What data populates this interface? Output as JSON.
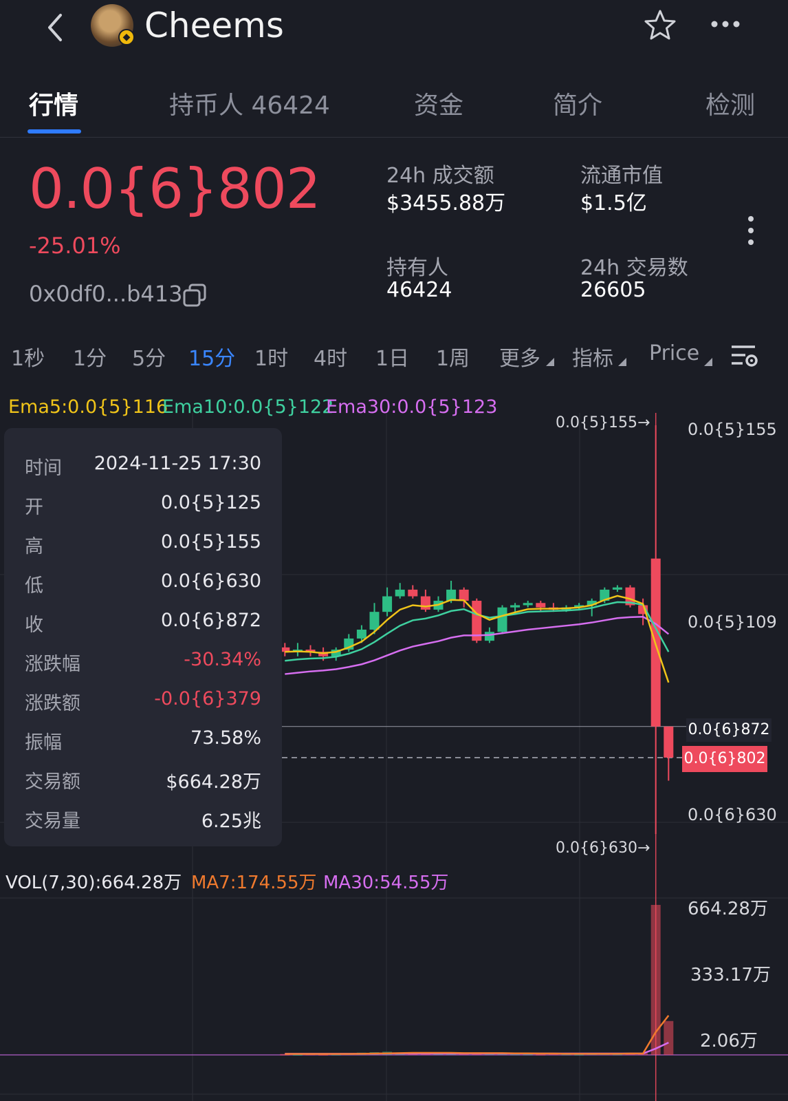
{
  "header": {
    "title": "Cheems",
    "colors": {
      "background": "#1b1d25",
      "up": "#2ebd85",
      "down": "#ee4a5d",
      "accent": "#2f7bff"
    }
  },
  "tabs": [
    {
      "label": "行情",
      "active": true
    },
    {
      "label": "持币人 46424",
      "active": false
    },
    {
      "label": "资金",
      "active": false
    },
    {
      "label": "简介",
      "active": false
    },
    {
      "label": "检测",
      "active": false
    }
  ],
  "summary": {
    "price": "0.0{6}802",
    "change": "-25.01%",
    "address": "0x0df0...b413",
    "stats": [
      {
        "label": "24h 成交额",
        "value": "$3455.88万"
      },
      {
        "label": "流通市值",
        "value": "$1.5亿"
      },
      {
        "label": "持有人",
        "value": "46424"
      },
      {
        "label": "24h 交易数",
        "value": "26605"
      }
    ]
  },
  "intervals": [
    {
      "label": "1秒",
      "active": false
    },
    {
      "label": "1分",
      "active": false
    },
    {
      "label": "5分",
      "active": false
    },
    {
      "label": "15分",
      "active": true
    },
    {
      "label": "1时",
      "active": false
    },
    {
      "label": "4时",
      "active": false
    },
    {
      "label": "1日",
      "active": false
    },
    {
      "label": "1周",
      "active": false
    },
    {
      "label": "更多",
      "active": false
    },
    {
      "label": "指标",
      "active": false
    },
    {
      "label": "Price",
      "active": false
    }
  ],
  "ema_legend": [
    {
      "text": "Ema5:0.0{5}116",
      "color": "#f0c419"
    },
    {
      "text": "Ema10:0.0{5}122",
      "color": "#3fd1a0"
    },
    {
      "text": "Ema30:0.0{5}123",
      "color": "#d66ef0"
    }
  ],
  "tooltip": {
    "rows": [
      {
        "label": "时间",
        "value": "2024-11-25 17:30",
        "negative": false
      },
      {
        "label": "开",
        "value": "0.0{5}125",
        "negative": false
      },
      {
        "label": "高",
        "value": "0.0{5}155",
        "negative": false
      },
      {
        "label": "低",
        "value": "0.0{6}630",
        "negative": false
      },
      {
        "label": "收",
        "value": "0.0{6}872",
        "negative": false
      },
      {
        "label": "涨跌幅",
        "value": "-30.34%",
        "negative": true
      },
      {
        "label": "涨跌额",
        "value": "-0.0{6}379",
        "negative": true
      },
      {
        "label": "振幅",
        "value": "73.58%",
        "negative": false
      },
      {
        "label": "交易额",
        "value": "$664.28万",
        "negative": false
      },
      {
        "label": "交易量",
        "value": "6.25兆",
        "negative": false
      }
    ]
  },
  "price_axis": {
    "labels": [
      "0.0{5}155",
      "0.0{5}109",
      "0.0{6}630"
    ],
    "crosshair_label": "0.0{6}872",
    "current_price_label": "0.0{6}802",
    "high_marker": "0.0{5}155→",
    "low_marker": "0.0{6}630→"
  },
  "volume": {
    "legend": [
      {
        "text": "VOL(7,30):664.28万",
        "color": "#e9e9ee"
      },
      {
        "text": "MA7:174.55万",
        "color": "#f07a2e"
      },
      {
        "text": "MA30:54.55万",
        "color": "#d66ef0"
      }
    ],
    "axis_labels": [
      "664.28万",
      "333.17万",
      "2.06万"
    ]
  },
  "chart_data": {
    "type": "candlestick",
    "price_unit_note_axis": [
      "0.0{5}155",
      "0.0{5}109",
      "0.0{6}630"
    ],
    "candles": [
      {
        "o": 1.05,
        "c": 1.04,
        "h": 1.06,
        "l": 1.03
      },
      {
        "o": 1.04,
        "c": 1.045,
        "h": 1.06,
        "l": 1.03
      },
      {
        "o": 1.045,
        "c": 1.04,
        "h": 1.055,
        "l": 1.03
      },
      {
        "o": 1.04,
        "c": 1.03,
        "h": 1.05,
        "l": 1.02
      },
      {
        "o": 1.03,
        "c": 1.045,
        "h": 1.05,
        "l": 1.02
      },
      {
        "o": 1.045,
        "c": 1.07,
        "h": 1.08,
        "l": 1.04
      },
      {
        "o": 1.07,
        "c": 1.09,
        "h": 1.1,
        "l": 1.06
      },
      {
        "o": 1.09,
        "c": 1.13,
        "h": 1.15,
        "l": 1.08
      },
      {
        "o": 1.13,
        "c": 1.165,
        "h": 1.185,
        "l": 1.12
      },
      {
        "o": 1.165,
        "c": 1.18,
        "h": 1.195,
        "l": 1.16
      },
      {
        "o": 1.18,
        "c": 1.165,
        "h": 1.19,
        "l": 1.16
      },
      {
        "o": 1.165,
        "c": 1.135,
        "h": 1.18,
        "l": 1.13
      },
      {
        "o": 1.135,
        "c": 1.155,
        "h": 1.165,
        "l": 1.13
      },
      {
        "o": 1.155,
        "c": 1.18,
        "h": 1.2,
        "l": 1.15
      },
      {
        "o": 1.18,
        "c": 1.155,
        "h": 1.185,
        "l": 1.14
      },
      {
        "o": 1.155,
        "c": 1.065,
        "h": 1.16,
        "l": 1.06
      },
      {
        "o": 1.065,
        "c": 1.085,
        "h": 1.095,
        "l": 1.06
      },
      {
        "o": 1.085,
        "c": 1.14,
        "h": 1.145,
        "l": 1.08
      },
      {
        "o": 1.14,
        "c": 1.145,
        "h": 1.15,
        "l": 1.125
      },
      {
        "o": 1.145,
        "c": 1.15,
        "h": 1.155,
        "l": 1.14
      },
      {
        "o": 1.15,
        "c": 1.14,
        "h": 1.155,
        "l": 1.13
      },
      {
        "o": 1.14,
        "c": 1.135,
        "h": 1.15,
        "l": 1.13
      },
      {
        "o": 1.135,
        "c": 1.14,
        "h": 1.145,
        "l": 1.13
      },
      {
        "o": 1.14,
        "c": 1.145,
        "h": 1.15,
        "l": 1.135
      },
      {
        "o": 1.145,
        "c": 1.155,
        "h": 1.16,
        "l": 1.12
      },
      {
        "o": 1.155,
        "c": 1.18,
        "h": 1.185,
        "l": 1.15
      },
      {
        "o": 1.18,
        "c": 1.185,
        "h": 1.19,
        "l": 1.175
      },
      {
        "o": 1.185,
        "c": 1.145,
        "h": 1.19,
        "l": 1.14
      },
      {
        "o": 1.145,
        "c": 1.125,
        "h": 1.16,
        "l": 1.1
      },
      {
        "o": 1.25,
        "c": 0.872,
        "h": 1.55,
        "l": 0.63
      },
      {
        "o": 0.872,
        "c": 0.802,
        "h": 0.872,
        "l": 0.75
      }
    ],
    "ema5": [
      1.04,
      1.041,
      1.04,
      1.037,
      1.04,
      1.05,
      1.063,
      1.085,
      1.112,
      1.135,
      1.145,
      1.142,
      1.146,
      1.157,
      1.156,
      1.126,
      1.112,
      1.121,
      1.129,
      1.136,
      1.137,
      1.137,
      1.138,
      1.14,
      1.145,
      1.157,
      1.166,
      1.159,
      1.148,
      1.056,
      0.971
    ],
    "ema10": [
      1.02,
      1.023,
      1.025,
      1.026,
      1.029,
      1.036,
      1.046,
      1.062,
      1.081,
      1.099,
      1.111,
      1.115,
      1.122,
      1.132,
      1.136,
      1.124,
      1.117,
      1.121,
      1.125,
      1.13,
      1.131,
      1.132,
      1.133,
      1.135,
      1.139,
      1.146,
      1.152,
      1.151,
      1.146,
      1.093,
      1.04
    ],
    "ema30": [
      0.99,
      0.993,
      0.996,
      0.998,
      1.001,
      1.006,
      1.012,
      1.021,
      1.032,
      1.043,
      1.052,
      1.058,
      1.064,
      1.072,
      1.077,
      1.077,
      1.078,
      1.082,
      1.086,
      1.09,
      1.093,
      1.096,
      1.099,
      1.102,
      1.106,
      1.111,
      1.116,
      1.118,
      1.119,
      1.103,
      1.08
    ],
    "volume_wan": [
      4,
      3,
      5,
      3,
      4,
      6,
      10,
      12,
      14,
      10,
      7,
      6,
      8,
      9,
      6,
      11,
      8,
      7,
      5,
      5,
      4,
      6,
      5,
      4,
      6,
      7,
      5,
      6,
      8,
      664.28,
      150
    ],
    "vol_ma7_wan": [
      4,
      4,
      4,
      4,
      4,
      4,
      5,
      6,
      7,
      8,
      9,
      9,
      9,
      9,
      8,
      8,
      8,
      8,
      7,
      7,
      6,
      6,
      5,
      5,
      5,
      5,
      5,
      6,
      6,
      101,
      174.55
    ],
    "vol_ma30_wan": [
      5,
      5,
      5,
      5,
      5,
      5,
      5,
      5,
      6,
      6,
      6,
      6,
      6,
      6,
      6,
      6,
      6,
      6,
      6,
      6,
      6,
      6,
      6,
      6,
      6,
      6,
      6,
      6,
      6,
      28,
      54.55
    ],
    "x_range_index": [
      0,
      30
    ],
    "y_range": [
      0.63,
      1.55
    ],
    "volume_range_wan": [
      0,
      664.28
    ],
    "grid": true
  }
}
